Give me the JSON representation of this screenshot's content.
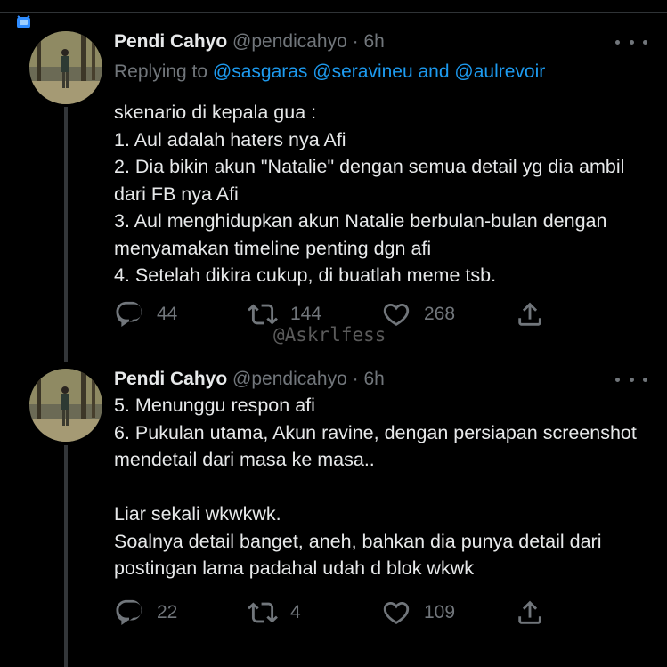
{
  "watermark": "@Askrlfess",
  "tweets": [
    {
      "name": "Pendi Cahyo",
      "handle": "@pendicahyo",
      "dot": "·",
      "time": "6h",
      "replying_prefix": "Replying to",
      "replying_mentions": [
        "@sasgaras",
        "@seravineu",
        "@aulrevoir"
      ],
      "replying_and": "and",
      "body": "skenario di kepala gua :\n1. Aul adalah haters nya Afi\n2. Dia bikin akun \"Natalie\" dengan semua detail yg dia ambil dari FB nya Afi\n3. Aul menghidupkan akun Natalie berbulan-bulan dengan menyamakan timeline penting dgn afi\n4. Setelah dikira cukup, di buatlah meme tsb.",
      "stats": {
        "replies": "44",
        "retweets": "144",
        "likes": "268"
      }
    },
    {
      "name": "Pendi Cahyo",
      "handle": "@pendicahyo",
      "dot": "·",
      "time": "6h",
      "body": "5. Menunggu respon afi\n6. Pukulan utama, Akun ravine, dengan persiapan screenshot mendetail dari masa ke masa..\n\nLiar sekali wkwkwk.\nSoalnya detail banget, aneh, bahkan dia punya detail dari postingan lama padahal udah d blok wkwk",
      "stats": {
        "replies": "22",
        "retweets": "4",
        "likes": "109"
      }
    }
  ],
  "colors": {
    "background": "#000000",
    "text": "#e7e9ea",
    "muted": "#71767b",
    "link": "#1d9bf0",
    "thread": "#333639"
  },
  "icons": [
    "reply-icon",
    "retweet-icon",
    "like-icon",
    "share-icon",
    "more-icon",
    "status-badge-icon"
  ]
}
